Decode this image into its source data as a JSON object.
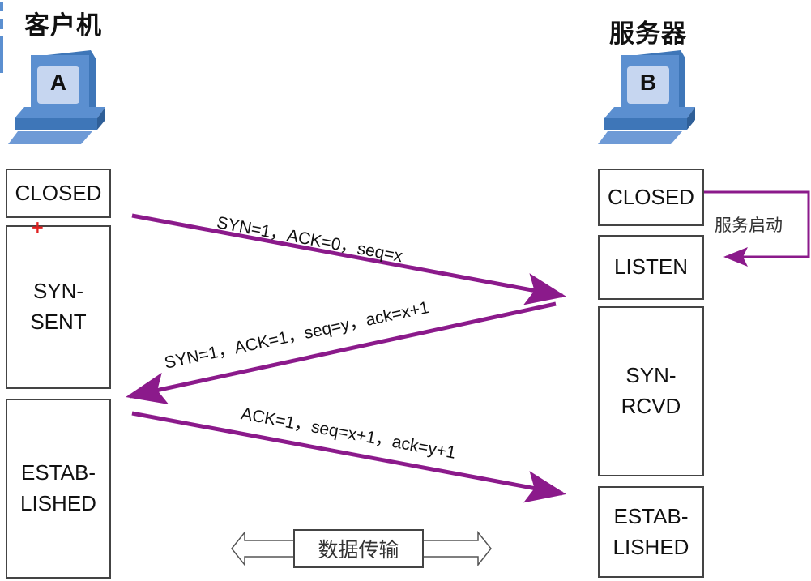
{
  "client": {
    "title": "客户机",
    "icon_letter": "A",
    "states": [
      "CLOSED",
      "SYN-\nSENT",
      "ESTAB-\nLISHED"
    ]
  },
  "server": {
    "title": "服务器",
    "icon_letter": "B",
    "states": [
      "CLOSED",
      "LISTEN",
      "SYN-\nRCVD",
      "ESTAB-\nLISHED"
    ],
    "start_label": "服务启动"
  },
  "messages": [
    {
      "direction": "client-to-server",
      "label": "SYN=1，ACK=0，seq=x"
    },
    {
      "direction": "server-to-client",
      "label": "SYN=1，ACK=1，seq=y，ack=x+1"
    },
    {
      "direction": "client-to-server",
      "label": "ACK=1，seq=x+1，ack=y+1"
    }
  ],
  "data_transfer": {
    "label": "数据传输"
  },
  "colors": {
    "arrow": "#8b1a8b",
    "computer_dark": "#3e76b8",
    "computer_mid": "#5b8fd0",
    "computer_light": "#c6d6f0",
    "box_border": "#444444"
  }
}
